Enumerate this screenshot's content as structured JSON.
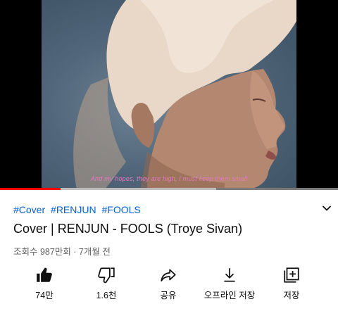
{
  "player": {
    "subtitle": "And my hopes, they are high, I must keep them small",
    "progress": {
      "played_fraction": 0.18,
      "buffered_fraction": 0.64
    }
  },
  "video": {
    "hashtags": [
      "#Cover",
      "#RENJUN",
      "#FOOLS"
    ],
    "title": "Cover | RENJUN - FOOLS (Troye Sivan)",
    "meta": "조회수 987만회 · 7개월 전"
  },
  "actions": {
    "like": {
      "label": "74만",
      "icon": "thumbs-up-icon"
    },
    "dislike": {
      "label": "1.6천",
      "icon": "thumbs-down-icon"
    },
    "share": {
      "label": "공유",
      "icon": "share-icon"
    },
    "download": {
      "label": "오프라인 저장",
      "icon": "download-icon"
    },
    "save": {
      "label": "저장",
      "icon": "playlist-add-icon"
    }
  },
  "colors": {
    "link": "#065fd4",
    "progress_played": "#ff0000",
    "subtitle": "#e37bc0"
  }
}
